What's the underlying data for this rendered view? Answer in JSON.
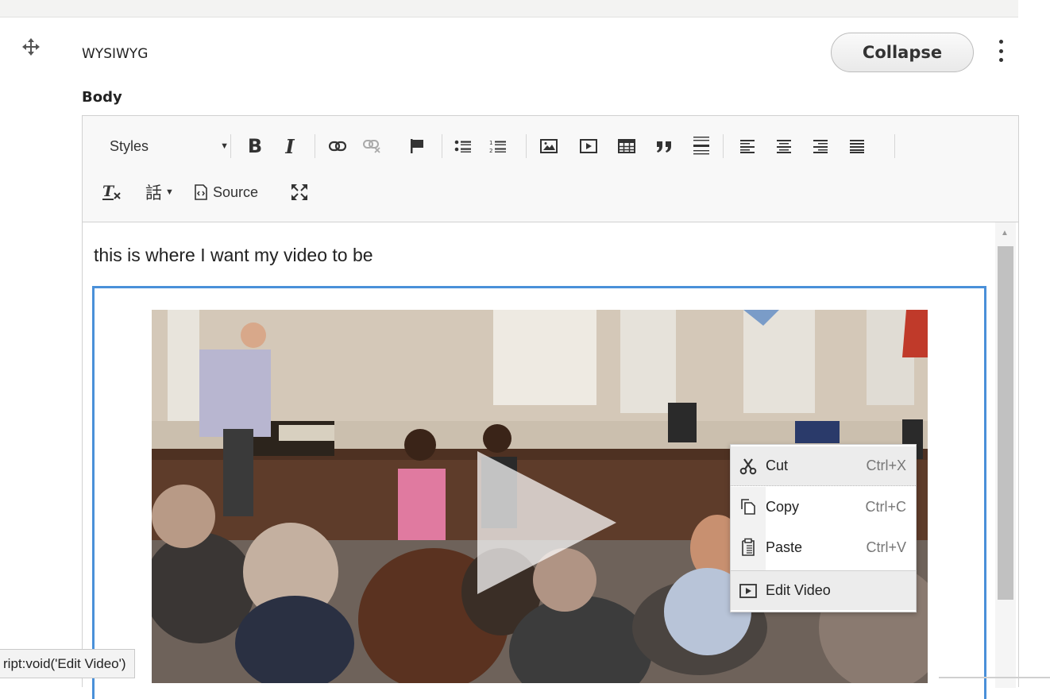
{
  "paragraph": {
    "type_label": "WYSIWYG",
    "collapse_label": "Collapse"
  },
  "field": {
    "label": "Body"
  },
  "toolbar": {
    "styles_label": "Styles",
    "bold_label": "B",
    "italic_label": "I",
    "source_label": "Source",
    "language_label": "話"
  },
  "editor": {
    "content_text": "this is where I want my video to be"
  },
  "context_menu": {
    "items": [
      {
        "label": "Cut",
        "shortcut": "Ctrl+X"
      },
      {
        "label": "Copy",
        "shortcut": "Ctrl+C"
      },
      {
        "label": "Paste",
        "shortcut": "Ctrl+V"
      },
      {
        "label": "Edit Video",
        "shortcut": ""
      }
    ]
  },
  "status_bar": {
    "text": "ript:void('Edit Video')"
  }
}
